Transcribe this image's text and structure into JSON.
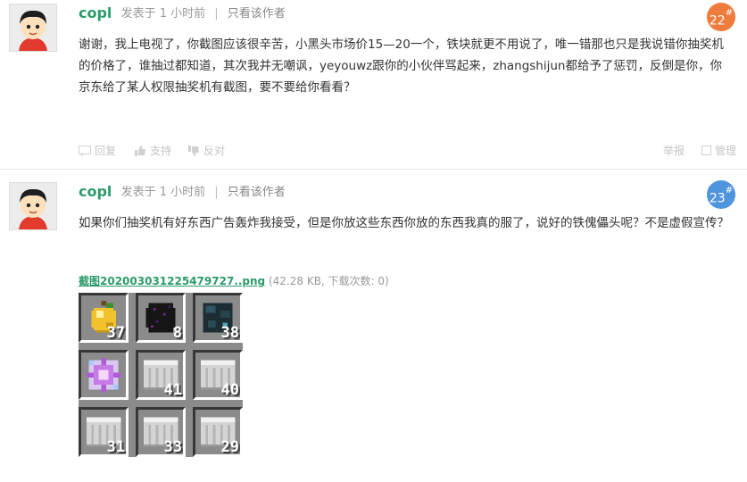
{
  "posts": [
    {
      "author": "copl",
      "posted": "发表于 1 小时前",
      "separator": "|",
      "only_author": "只看该作者",
      "floor": "22",
      "floor_mark": "#",
      "body": "谢谢，我上电视了，你截图应该很辛苦，小黑头市场价15—20一个，铁块就更不用说了，唯一错那也只是我说错你抽奖机的价格了，谁抽过都知道，其次我并无嘲讽，yeyouwz跟你的小伙伴骂起来，zhangshijun都给予了惩罚，反倒是你，你京东给了某人权限抽奖机有截图，要不要给你看看？",
      "actions": {
        "reply": "回复",
        "upvote": "支持",
        "downvote": "反对",
        "report": "举报",
        "manage": "管理"
      }
    },
    {
      "author": "copl",
      "posted": "发表于 1 小时前",
      "separator": "|",
      "only_author": "只看该作者",
      "floor": "23",
      "floor_mark": "#",
      "body": "如果你们抽奖机有好东西广告轰炸我接受，但是你放这些东西你放的东西我真的服了，说好的铁傀儡头呢？不是虚假宣传？",
      "attachment": {
        "filename": "截图202003031225479727..png",
        "info": "(42.28 KB, 下载次数: 0)"
      },
      "inventory": [
        {
          "item": "golden-apple",
          "count": "37"
        },
        {
          "item": "dragon-egg",
          "count": "8"
        },
        {
          "item": "dark-head",
          "count": "38"
        },
        {
          "item": "nether-star",
          "count": ""
        },
        {
          "item": "iron-block",
          "count": "41"
        },
        {
          "item": "iron-block",
          "count": "40"
        },
        {
          "item": "iron-block",
          "count": "31"
        },
        {
          "item": "iron-block",
          "count": "33"
        },
        {
          "item": "iron-block",
          "count": "29"
        }
      ]
    }
  ]
}
